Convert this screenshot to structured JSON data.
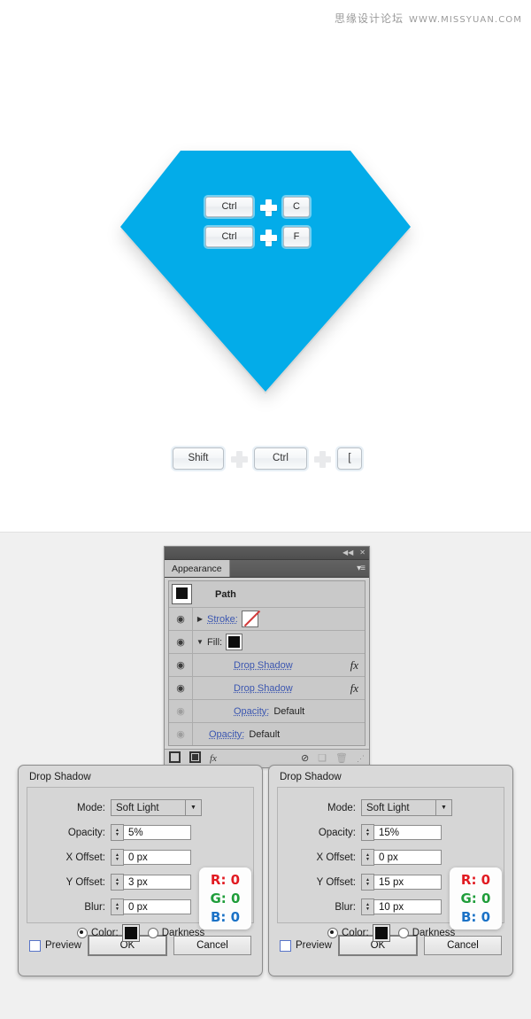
{
  "watermark": {
    "cn": "思缘设计论坛",
    "url": "WWW.MISSYUAN.COM"
  },
  "canvas": {
    "shape_color": "#03ace9",
    "shortcuts_on_shape": [
      {
        "key1": "Ctrl",
        "plus": "plus-icon",
        "key2": "C"
      },
      {
        "key1": "Ctrl",
        "plus": "plus-icon",
        "key2": "F"
      }
    ],
    "shortcut_strip": {
      "key1": "Shift",
      "key2": "Ctrl",
      "key3": "[",
      "plus": "plus-icon"
    }
  },
  "panel": {
    "title": "Appearance",
    "collapse_icon": "◀◀",
    "close_icon": "✕",
    "menu_icon": "▾≡",
    "rows": [
      {
        "type": "header",
        "label": "Path",
        "eye": false,
        "thumb": "path-thumb"
      },
      {
        "type": "item",
        "label": "Stroke:",
        "eye": true,
        "triangle": "▶",
        "swatch": "none",
        "link": true
      },
      {
        "type": "item",
        "label": "Fill:",
        "eye": true,
        "triangle": "▼",
        "swatch": "black",
        "link": false
      },
      {
        "type": "effect",
        "label": "Drop Shadow",
        "eye": true,
        "fx": "fx",
        "link": true
      },
      {
        "type": "effect",
        "label": "Drop Shadow",
        "eye": true,
        "fx": "fx",
        "link": true
      },
      {
        "type": "opacity",
        "label": "Opacity:",
        "value": "Default",
        "eye": "dim",
        "link": true,
        "indent": 1
      },
      {
        "type": "opacity",
        "label": "Opacity:",
        "value": "Default",
        "eye": "dim",
        "link": true,
        "indent": 0
      }
    ],
    "footer_icons": [
      "new-stroke-icon",
      "new-fill-icon",
      "add-effect-fx-icon",
      "clear-appearance-icon",
      "duplicate-item-icon",
      "delete-item-icon",
      "resize-grip-icon"
    ],
    "footer_fx_label": "fx",
    "footer_clear_glyph": "⊘",
    "footer_dup_glyph": "❑",
    "footer_trash_glyph": "🗑",
    "footer_grip_glyph": "⋰"
  },
  "dialogs": [
    {
      "title": "Drop Shadow",
      "mode_label": "Mode:",
      "mode_value": "Soft Light",
      "opacity_label": "Opacity:",
      "opacity_value": "5%",
      "x_offset_label": "X Offset:",
      "x_offset_value": "0 px",
      "y_offset_label": "Y Offset:",
      "y_offset_value": "3 px",
      "blur_label": "Blur:",
      "blur_value": "0 px",
      "color_label": "Color:",
      "darkness_label": "Darkness",
      "color_selected": true,
      "color_swatch": "#0d0d0d",
      "preview_label": "Preview",
      "preview_checked": false,
      "ok_label": "OK",
      "cancel_label": "Cancel",
      "callout": {
        "r": "R: 0",
        "g": "G: 0",
        "b": "B: 0"
      }
    },
    {
      "title": "Drop Shadow",
      "mode_label": "Mode:",
      "mode_value": "Soft Light",
      "opacity_label": "Opacity:",
      "opacity_value": "15%",
      "x_offset_label": "X Offset:",
      "x_offset_value": "0 px",
      "y_offset_label": "Y Offset:",
      "y_offset_value": "15 px",
      "blur_label": "Blur:",
      "blur_value": "10 px",
      "color_label": "Color:",
      "darkness_label": "Darkness",
      "color_selected": true,
      "color_swatch": "#0d0d0d",
      "preview_label": "Preview",
      "preview_checked": false,
      "ok_label": "OK",
      "cancel_label": "Cancel",
      "callout": {
        "r": "R: 0",
        "g": "G: 0",
        "b": "B: 0"
      }
    }
  ]
}
